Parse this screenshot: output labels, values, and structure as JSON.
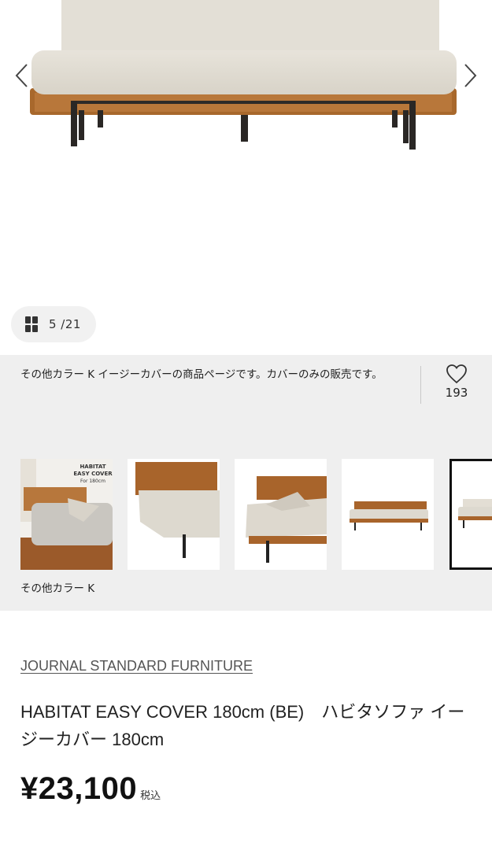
{
  "gallery": {
    "counter": "5 /21",
    "icons": {
      "prev": "chevron-left-icon",
      "next": "chevron-right-icon",
      "grid": "grid-icon"
    }
  },
  "description": "その他カラー K イージーカバーの商品ページです。カバーのみの販売です。",
  "like": {
    "icon": "heart-icon",
    "count": "193"
  },
  "thumbnails": {
    "first_label_lines": [
      "HABITAT",
      "EASY COVER",
      "For 180cm"
    ],
    "caption": "その他カラー K"
  },
  "product": {
    "brand": "JOURNAL STANDARD FURNITURE",
    "title": "HABITAT EASY COVER 180cm (BE)　ハビタソファ イージーカバー 180cm",
    "price": "¥23,100",
    "tax_label": "税込"
  }
}
